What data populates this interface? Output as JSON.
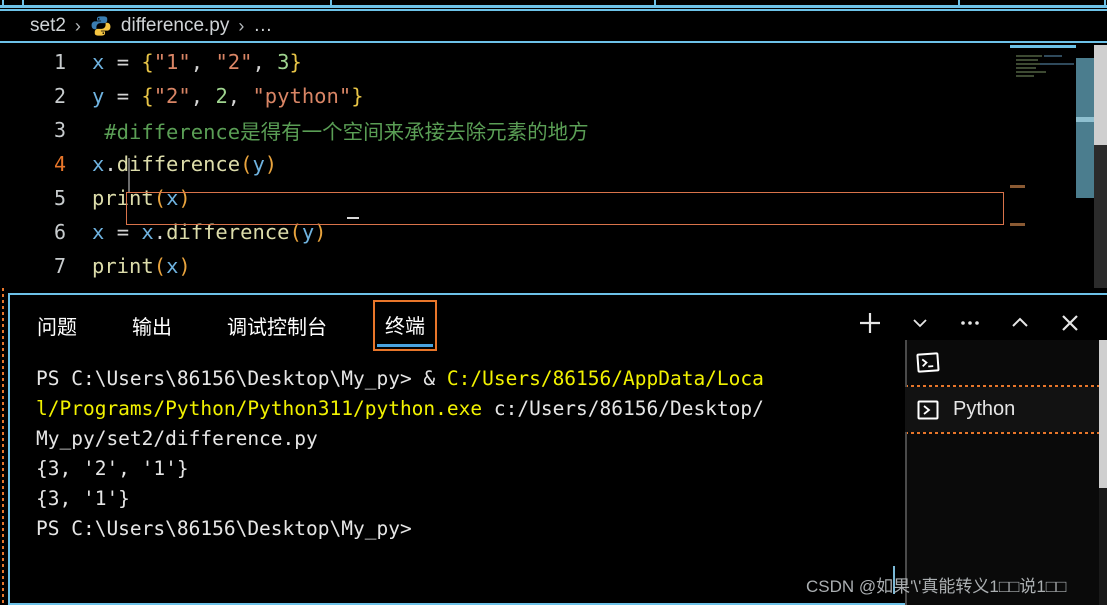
{
  "window": {
    "theme_bg": "#000000",
    "accent_focus": "#6dc2e8",
    "accent_orange": "#e8762a"
  },
  "tabstrip": {
    "tick_positions": [
      2,
      22,
      330,
      654,
      958,
      1104
    ]
  },
  "breadcrumb": {
    "items": [
      {
        "label": "set2",
        "icon": ""
      },
      {
        "label": "difference.py",
        "icon": "python-icon"
      },
      {
        "label": "…",
        "icon": ""
      }
    ],
    "separator": "›",
    "ellipsis": "…"
  },
  "editor": {
    "active_line": 4,
    "lines": [
      {
        "number": "1",
        "tokens": [
          {
            "t": "x",
            "c": "t-var"
          },
          {
            "t": " ",
            "c": "t-punc"
          },
          {
            "t": "=",
            "c": "t-op"
          },
          {
            "t": " ",
            "c": "t-punc"
          },
          {
            "t": "{",
            "c": "t-brc"
          },
          {
            "t": "\"1\"",
            "c": "t-str"
          },
          {
            "t": ",",
            "c": "t-punc"
          },
          {
            "t": " ",
            "c": "t-punc"
          },
          {
            "t": "\"2\"",
            "c": "t-str"
          },
          {
            "t": ",",
            "c": "t-punc"
          },
          {
            "t": " ",
            "c": "t-punc"
          },
          {
            "t": "3",
            "c": "t-num"
          },
          {
            "t": "}",
            "c": "t-brc"
          }
        ]
      },
      {
        "number": "2",
        "tokens": [
          {
            "t": "y",
            "c": "t-var"
          },
          {
            "t": " ",
            "c": "t-punc"
          },
          {
            "t": "=",
            "c": "t-op"
          },
          {
            "t": " ",
            "c": "t-punc"
          },
          {
            "t": "{",
            "c": "t-brc"
          },
          {
            "t": "\"2\"",
            "c": "t-str"
          },
          {
            "t": ",",
            "c": "t-punc"
          },
          {
            "t": " ",
            "c": "t-punc"
          },
          {
            "t": "2",
            "c": "t-num"
          },
          {
            "t": ",",
            "c": "t-punc"
          },
          {
            "t": " ",
            "c": "t-punc"
          },
          {
            "t": "\"python\"",
            "c": "t-str"
          },
          {
            "t": "}",
            "c": "t-brc"
          }
        ]
      },
      {
        "number": "3",
        "tokens": [
          {
            "t": " #difference是得有一个空间来承接去除元素的地方",
            "c": "t-com"
          }
        ]
      },
      {
        "number": "4",
        "tokens": [
          {
            "t": "x",
            "c": "t-var"
          },
          {
            "t": ".",
            "c": "t-punc"
          },
          {
            "t": "difference",
            "c": "t-fn"
          },
          {
            "t": "(",
            "c": "t-paren"
          },
          {
            "t": "y",
            "c": "t-var"
          },
          {
            "t": ")",
            "c": "t-paren"
          }
        ]
      },
      {
        "number": "5",
        "tokens": [
          {
            "t": "print",
            "c": "t-fn"
          },
          {
            "t": "(",
            "c": "t-paren"
          },
          {
            "t": "x",
            "c": "t-var"
          },
          {
            "t": ")",
            "c": "t-paren"
          }
        ]
      },
      {
        "number": "6",
        "tokens": [
          {
            "t": "x",
            "c": "t-var"
          },
          {
            "t": " ",
            "c": "t-punc"
          },
          {
            "t": "=",
            "c": "t-op"
          },
          {
            "t": " ",
            "c": "t-punc"
          },
          {
            "t": "x",
            "c": "t-var"
          },
          {
            "t": ".",
            "c": "t-punc"
          },
          {
            "t": "difference",
            "c": "t-fn"
          },
          {
            "t": "(",
            "c": "t-paren"
          },
          {
            "t": "y",
            "c": "t-var"
          },
          {
            "t": ")",
            "c": "t-paren"
          }
        ]
      },
      {
        "number": "7",
        "tokens": [
          {
            "t": "print",
            "c": "t-fn"
          },
          {
            "t": "(",
            "c": "t-paren"
          },
          {
            "t": "x",
            "c": "t-var"
          },
          {
            "t": ")",
            "c": "t-paren"
          }
        ]
      }
    ]
  },
  "panel": {
    "tabs": [
      {
        "id": "problems",
        "label": "问题",
        "active": false
      },
      {
        "id": "output",
        "label": "输出",
        "active": false
      },
      {
        "id": "debug-console",
        "label": "调试控制台",
        "active": false
      },
      {
        "id": "terminal",
        "label": "终端",
        "active": true
      }
    ],
    "actions": [
      {
        "id": "new-terminal",
        "icon": "plus-icon"
      },
      {
        "id": "terminal-profile",
        "icon": "chevron-down-icon"
      },
      {
        "id": "panel-more",
        "icon": "ellipsis-icon"
      },
      {
        "id": "maximize-panel",
        "icon": "chevron-up-icon"
      },
      {
        "id": "close-panel",
        "icon": "close-icon"
      }
    ]
  },
  "terminal": {
    "lines": [
      [
        {
          "t": "PS C:\\Users\\86156\\Desktop\\My_py> & ",
          "c": ""
        },
        {
          "t": "C:/Users/86156/AppData/Loca",
          "c": "tl-yellow"
        }
      ],
      [
        {
          "t": "l/Programs/Python/Python311/python.exe",
          "c": "tl-yellow"
        },
        {
          "t": " c:/Users/86156/Desktop/",
          "c": ""
        }
      ],
      [
        {
          "t": "My_py/set2/difference.py",
          "c": ""
        }
      ],
      [
        {
          "t": "{3, '2', '1'}",
          "c": ""
        }
      ],
      [
        {
          "t": "{3, '1'}",
          "c": ""
        }
      ],
      [
        {
          "t": "PS C:\\Users\\86156\\Desktop\\My_py>",
          "c": ""
        }
      ]
    ]
  },
  "terminal_list": {
    "items": [
      {
        "id": "terminal-powershell",
        "label": "",
        "icon": "terminal-icon",
        "selected": false
      },
      {
        "id": "terminal-python",
        "label": "Python",
        "icon": "terminal-prompt-icon",
        "selected": true
      }
    ]
  },
  "watermark": {
    "text": "CSDN @如果'\\'真能转义1□□说1□□"
  }
}
